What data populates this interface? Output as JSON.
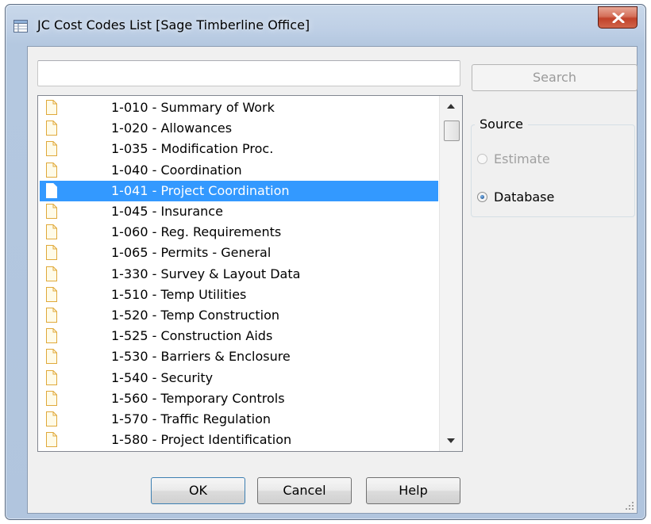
{
  "window": {
    "title": "JC Cost Codes List [Sage Timberline Office]",
    "close_glyph": "X"
  },
  "search": {
    "value": "",
    "placeholder": "",
    "button_label": "Search"
  },
  "list": {
    "items": [
      {
        "label": "1-010 - Summary of Work",
        "selected": false
      },
      {
        "label": "1-020 - Allowances",
        "selected": false
      },
      {
        "label": "1-035 - Modification Proc.",
        "selected": false
      },
      {
        "label": "1-040 - Coordination",
        "selected": false
      },
      {
        "label": "1-041 - Project Coordination",
        "selected": true
      },
      {
        "label": "1-045 - Insurance",
        "selected": false
      },
      {
        "label": "1-060 - Reg. Requirements",
        "selected": false
      },
      {
        "label": "1-065 - Permits - General",
        "selected": false
      },
      {
        "label": "1-330 - Survey & Layout Data",
        "selected": false
      },
      {
        "label": "1-510 - Temp Utilities",
        "selected": false
      },
      {
        "label": "1-520 - Temp Construction",
        "selected": false
      },
      {
        "label": "1-525 - Construction Aids",
        "selected": false
      },
      {
        "label": "1-530 - Barriers & Enclosure",
        "selected": false
      },
      {
        "label": "1-540 - Security",
        "selected": false
      },
      {
        "label": "1-560 - Temporary Controls",
        "selected": false
      },
      {
        "label": "1-570 - Traffic Regulation",
        "selected": false
      },
      {
        "label": "1-580 - Project Identification",
        "selected": false
      }
    ],
    "item_icon": "document-icon",
    "selection_color": "#3399ff"
  },
  "source": {
    "group_label": "Source",
    "options": [
      {
        "label": "Estimate",
        "checked": false,
        "enabled": false
      },
      {
        "label": "Database",
        "checked": true,
        "enabled": true
      }
    ]
  },
  "buttons": {
    "ok": "OK",
    "cancel": "Cancel",
    "help": "Help"
  },
  "colors": {
    "titlebar": "#b9cce3",
    "client_bg": "#f0f0f0",
    "close_button": "#c7452c"
  }
}
